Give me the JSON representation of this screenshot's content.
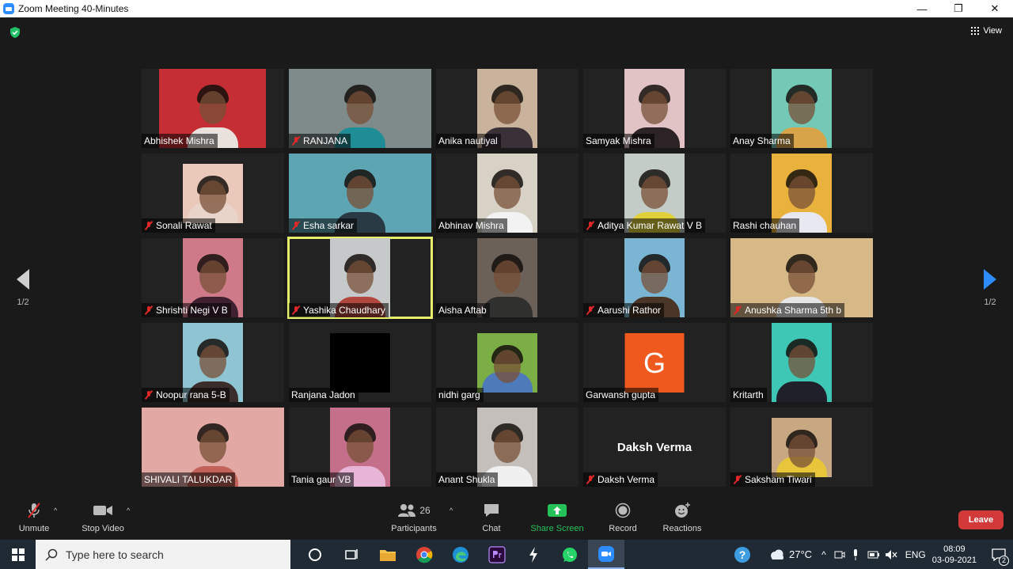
{
  "window": {
    "title": "Zoom Meeting 40-Minutes",
    "controls": [
      "—",
      "❐",
      "✕"
    ]
  },
  "view_label": "View",
  "pagination": {
    "left": "1/2",
    "right": "1/2"
  },
  "participants": [
    {
      "name": "Abhishek Mishra",
      "muted": false,
      "bg": "#c42e34",
      "shirt": "#e9e2dc"
    },
    {
      "name": "RANJANA",
      "muted": true,
      "bg": "#7f8a8a",
      "shirt": "#1f8d95"
    },
    {
      "name": "Anika nautiyal",
      "muted": false,
      "bg": "#c9b39c",
      "shirt": "#3a3038"
    },
    {
      "name": "Samyak Mishra",
      "muted": false,
      "bg": "#e1c3c5",
      "shirt": "#2b2325"
    },
    {
      "name": "Anay Sharma",
      "muted": false,
      "bg": "#73c8b6",
      "shirt": "#d7a44a"
    },
    {
      "name": "Sonali Rawat",
      "muted": true,
      "bg": "#eac9bb",
      "shirt": "#e8d4c9"
    },
    {
      "name": "Esha sarkar",
      "muted": true,
      "bg": "#5ea5b4",
      "shirt": "#2a3a44"
    },
    {
      "name": "Abhinav Mishra",
      "muted": false,
      "bg": "#d8d2c6",
      "shirt": "#f2f2f2"
    },
    {
      "name": "Aditya Kumar Rawat V B",
      "muted": true,
      "bg": "#c3ccc6",
      "shirt": "#e0d03a"
    },
    {
      "name": "Rashi chauhan",
      "muted": false,
      "bg": "#e9b23d",
      "shirt": "#e8e8f0"
    },
    {
      "name": "Shrishti Negi V B",
      "muted": true,
      "bg": "#cf7a88",
      "shirt": "#3f2030"
    },
    {
      "name": "Yashika Chaudhary",
      "muted": true,
      "bg": "#c5c9ca",
      "shirt": "#b2473f"
    },
    {
      "name": "Aisha Aftab",
      "muted": false,
      "bg": "#6b6159",
      "shirt": "#30302f"
    },
    {
      "name": "Aarushi Rathor",
      "muted": true,
      "bg": "#7ab6d3",
      "shirt": "#4b3526"
    },
    {
      "name": "Anushka Sharma 5th b",
      "muted": true,
      "bg": "#d7b887",
      "shirt": "#e6e6e6"
    },
    {
      "name": "Noopur rana 5-B",
      "muted": true,
      "bg": "#8fc4d2",
      "shirt": "#3a2d2b"
    },
    {
      "name": "Ranjana Jadon",
      "muted": false,
      "bg": "#000000",
      "shirt": "#000000"
    },
    {
      "name": "nidhi garg",
      "muted": false,
      "bg": "#7cae46",
      "shirt": "#4f7ab9"
    },
    {
      "name": "Garwansh gupta",
      "muted": false,
      "initial": "G"
    },
    {
      "name": "Kritarth",
      "muted": false,
      "bg": "#3fc7b6",
      "shirt": "#20202a"
    },
    {
      "name": "SHIVALI TALUKDAR",
      "muted": false,
      "bg": "#e2a8a4",
      "shirt": "#c26258"
    },
    {
      "name": "Tania gaur VB",
      "muted": false,
      "bg": "#c4708a",
      "shirt": "#e7b5d8"
    },
    {
      "name": "Anant Shukla",
      "muted": false,
      "bg": "#c4bfbb",
      "shirt": "#f0f0f0"
    },
    {
      "name": "Daksh Verma",
      "muted": true,
      "video_off": true
    },
    {
      "name": "Saksham Tiwari",
      "muted": true,
      "bg": "#c8a783",
      "shirt": "#e7c63b"
    }
  ],
  "toolbar": {
    "unmute": "Unmute",
    "stop_video": "Stop Video",
    "participants": "Participants",
    "participant_count": "26",
    "chat": "Chat",
    "share_screen": "Share Screen",
    "record": "Record",
    "reactions": "Reactions",
    "leave": "Leave"
  },
  "taskbar": {
    "search_placeholder": "Type here to search",
    "weather": "27°C",
    "language": "ENG",
    "time": "08:09",
    "date": "03-09-2021",
    "notification_count": "2"
  },
  "colors": {
    "accent": "#2d8cff",
    "active_speaker": "#e6ef6a",
    "share_green": "#25c25a",
    "leave_red": "#d23a3a",
    "garwansh_avatar": "#f0591e"
  }
}
